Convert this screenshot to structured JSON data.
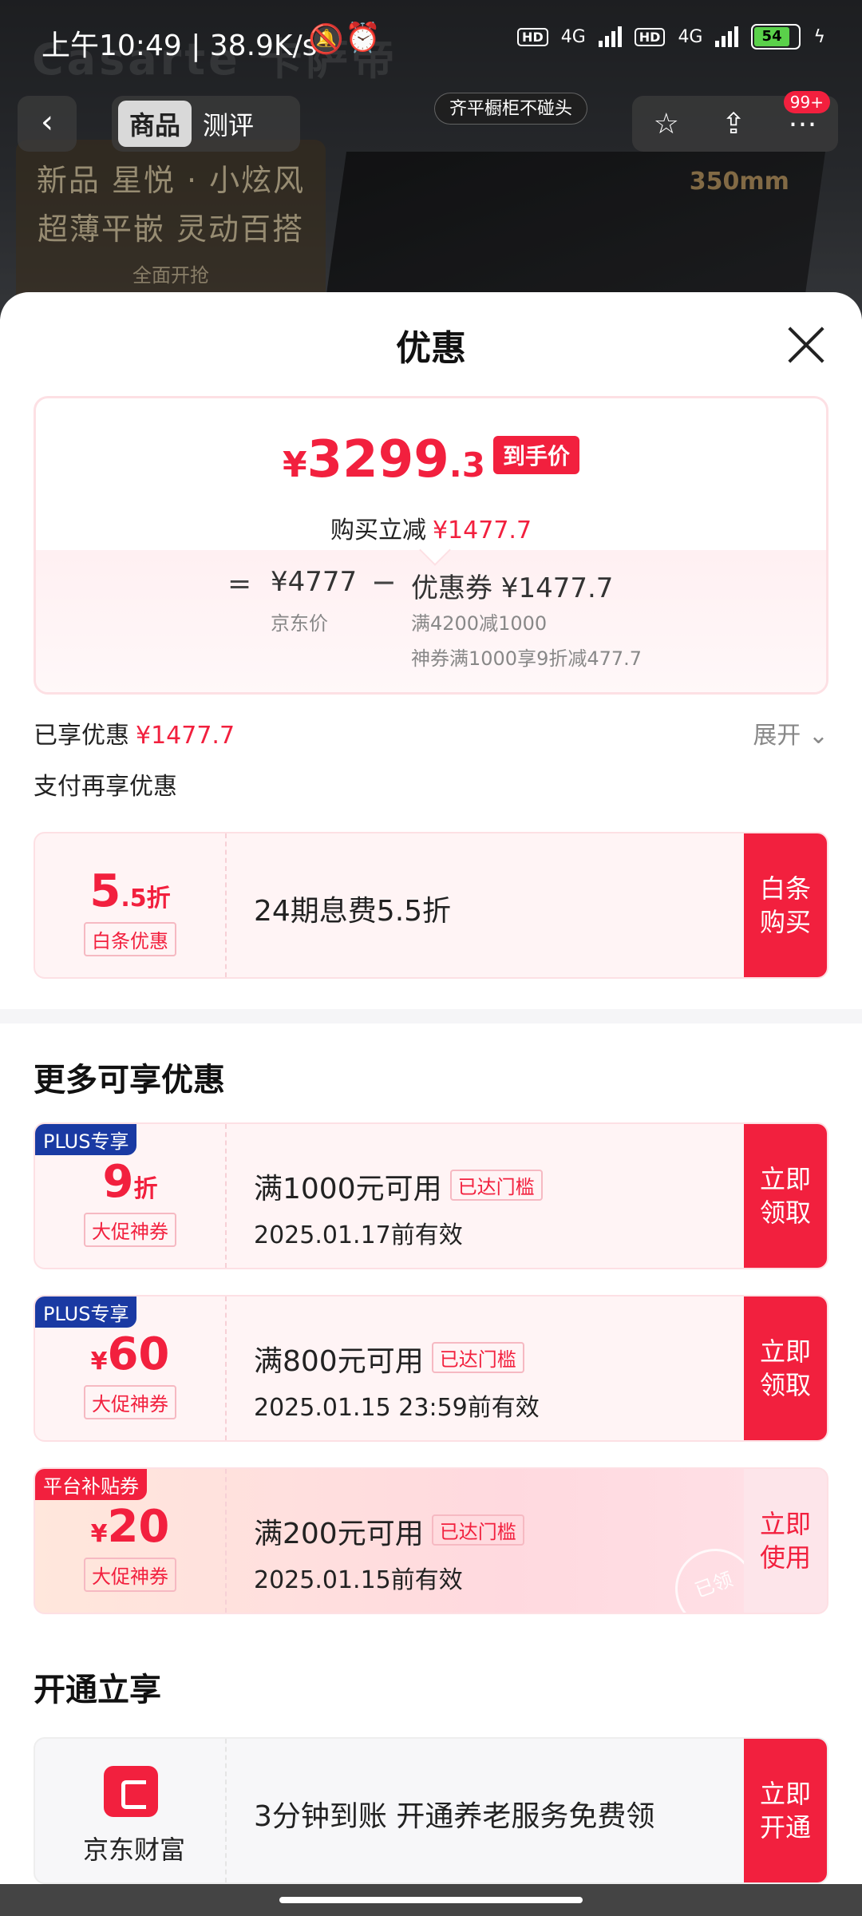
{
  "status_bar": {
    "time_speed": "上午10:49 | 38.9K/s",
    "network1": "4G",
    "network2": "4G",
    "hd": "HD",
    "battery": "54"
  },
  "background": {
    "brand": "Casarte 卡萨帝",
    "promo_line1": "新品 星悦 · 小炫风",
    "promo_line2": "超薄平嵌 灵动百搭",
    "promo_line3": "全面开抢",
    "size_label": "350mm",
    "tag_bubble": "齐平橱柜不碰头"
  },
  "nav": {
    "back_icon": "‹",
    "tabs": [
      "商品",
      "测评"
    ],
    "badge": "99+"
  },
  "sheet": {
    "title": "优惠",
    "price_card": {
      "currency": "¥",
      "price_int": "3299",
      "price_dec": ".3",
      "tag": "到手价",
      "reduce_label": "购买立减",
      "reduce_amount": "¥1477.7",
      "equals": "=",
      "jd_price": "¥4777",
      "jd_label": "京东价",
      "minus": "−",
      "coupon_line": "优惠券 ¥1477.7",
      "coupon_sub1": "满4200减1000",
      "coupon_sub2": "神券满1000享9折减477.7"
    },
    "enjoyed_label": "已享优惠",
    "enjoyed_amount": "¥1477.7",
    "expand_label": "展开 ⌄",
    "pay_more": "支付再享优惠",
    "baitiao": {
      "amount_big": "5",
      "amount_small": ".5折",
      "label": "白条优惠",
      "text": "24期息费5.5折",
      "button": "白条购买"
    },
    "more_title": "更多可享优惠",
    "coupons": [
      {
        "corner": "PLUS专享",
        "amount_big": "9",
        "amount_small": "折",
        "label": "大促神券",
        "title": "满1000元可用",
        "reach": "已达门槛",
        "date": "2025.01.17前有效",
        "button": "立即领取"
      },
      {
        "corner": "PLUS专享",
        "amount_prefix": "¥",
        "amount_big": "60",
        "label": "大促神券",
        "title": "满800元可用",
        "reach": "已达门槛",
        "date": "2025.01.15 23:59前有效",
        "button": "立即领取"
      },
      {
        "corner": "平台补贴券",
        "amount_prefix": "¥",
        "amount_big": "20",
        "label": "大促神券",
        "title": "满200元可用",
        "reach": "已达门槛",
        "date": "2025.01.15前有效",
        "button": "立即使用",
        "stamp": "已领"
      }
    ],
    "open_title": "开通立享",
    "jd_finance": {
      "name": "京东财富",
      "text": "3分钟到账 开通养老服务免费领",
      "button": "立即开通"
    }
  }
}
